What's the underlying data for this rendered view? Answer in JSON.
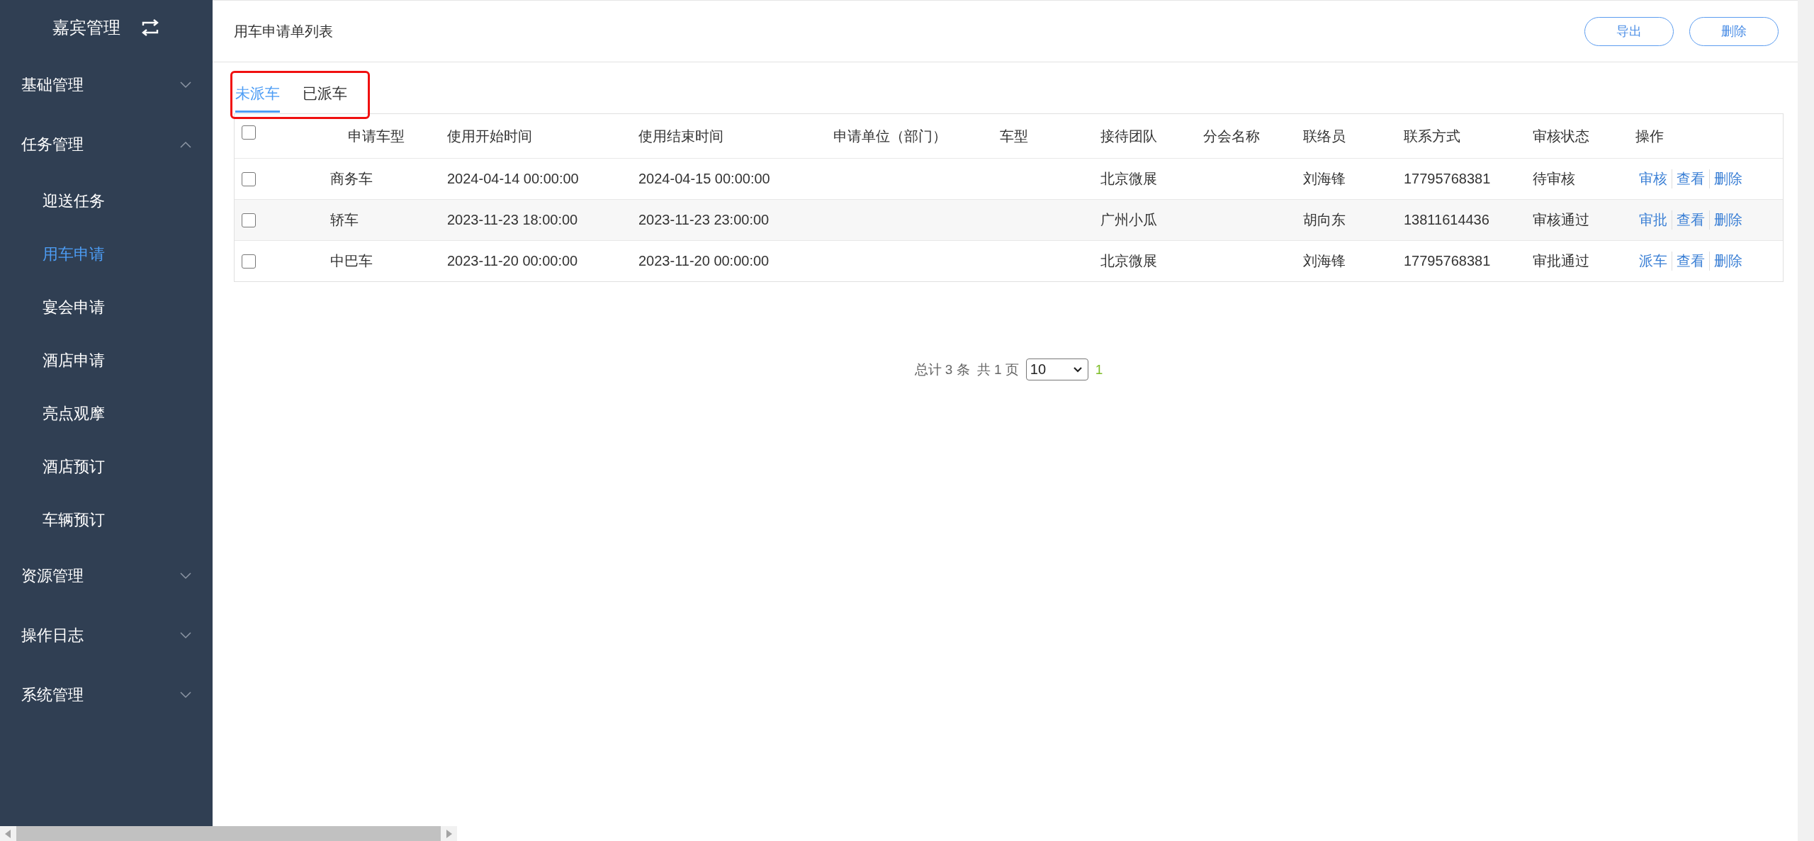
{
  "sidebar": {
    "title": "嘉宾管理",
    "groups": [
      {
        "label": "基础管理",
        "expanded": false
      },
      {
        "label": "任务管理",
        "expanded": true,
        "children": [
          {
            "label": "迎送任务",
            "selected": false
          },
          {
            "label": "用车申请",
            "selected": true
          },
          {
            "label": "宴会申请",
            "selected": false
          },
          {
            "label": "酒店申请",
            "selected": false
          },
          {
            "label": "亮点观摩",
            "selected": false
          },
          {
            "label": "酒店预订",
            "selected": false
          },
          {
            "label": "车辆预订",
            "selected": false
          }
        ]
      },
      {
        "label": "资源管理",
        "expanded": false
      },
      {
        "label": "操作日志",
        "expanded": false
      },
      {
        "label": "系统管理",
        "expanded": false
      }
    ]
  },
  "page": {
    "title": "用车申请单列表",
    "buttons": [
      "导出",
      "删除"
    ]
  },
  "tabs": {
    "highlighted": true,
    "items": [
      {
        "label": "未派车",
        "selected": true
      },
      {
        "label": "已派车",
        "selected": false
      }
    ]
  },
  "table": {
    "select_all": {
      "checked": false
    },
    "columns": [
      "申请车型",
      "使用开始时间",
      "使用结束时间",
      "申请单位（部门）",
      "车型",
      "接待团队",
      "分会名称",
      "联络员",
      "联系方式",
      "审核状态",
      "操作"
    ],
    "rows": [
      {
        "checked": false,
        "cells": [
          "商务车",
          "2024-04-14 00:00:00",
          "2024-04-15 00:00:00",
          "",
          "",
          "北京微展",
          "",
          "刘海锋",
          "17795768381",
          "待审核"
        ],
        "actions": [
          "审核",
          "查看",
          "删除"
        ]
      },
      {
        "checked": false,
        "cells": [
          "轿车",
          "2023-11-23 18:00:00",
          "2023-11-23 23:00:00",
          "",
          "",
          "广州小瓜",
          "",
          "胡向东",
          "13811614436",
          "审核通过"
        ],
        "actions": [
          "审批",
          "查看",
          "删除"
        ]
      },
      {
        "checked": false,
        "cells": [
          "中巴车",
          "2023-11-20 00:00:00",
          "2023-11-20 00:00:00",
          "",
          "",
          "北京微展",
          "",
          "刘海锋",
          "17795768381",
          "审批通过"
        ],
        "actions": [
          "派车",
          "查看",
          "删除"
        ]
      }
    ]
  },
  "pagination": {
    "total": "总计 3 条",
    "pages": "共 1 页",
    "page_size": "10",
    "current_page": "1"
  }
}
